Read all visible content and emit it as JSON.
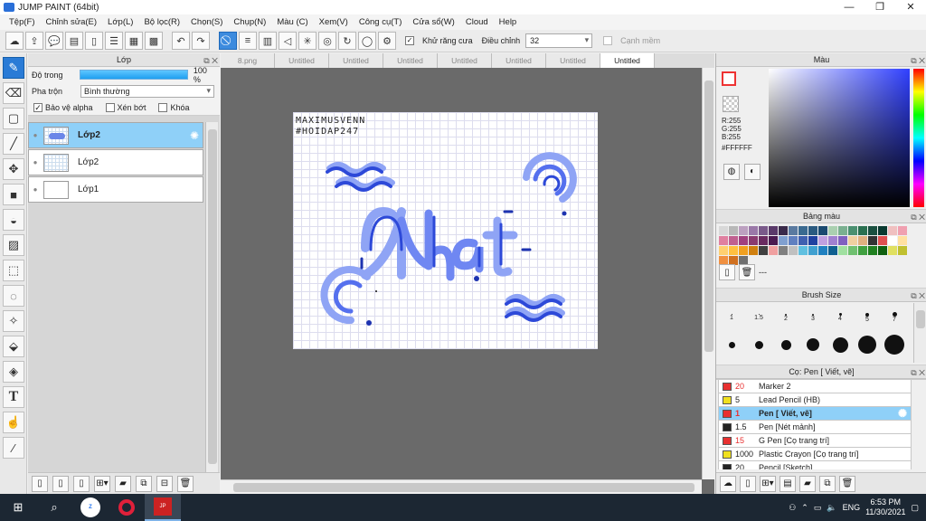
{
  "window": {
    "title": "JUMP PAINT (64bit)"
  },
  "menu": [
    "Tệp(F)",
    "Chỉnh sửa(E)",
    "Lớp(L)",
    "Bộ lọc(R)",
    "Chọn(S)",
    "Chụp(N)",
    "Màu (C)",
    "Xem(V)",
    "Công cụ(T)",
    "Cửa sổ(W)",
    "Cloud",
    "Help"
  ],
  "toolbar": {
    "antialias_label": "Khử răng cưa",
    "adjust_label": "Điều chỉnh",
    "adjust_value": "32",
    "smooth_label": "Cạnh mềm"
  },
  "layers_panel": {
    "title": "Lớp",
    "opacity_label": "Độ trong",
    "opacity_value": "100 %",
    "blend_label": "Pha trộn",
    "blend_value": "Bình thường",
    "opt_alpha": "Bảo vệ alpha",
    "opt_clip": "Xén bớt",
    "opt_lock": "Khóa",
    "layers": [
      {
        "name": "Lớp2",
        "selected": true
      },
      {
        "name": "Lớp2",
        "selected": false
      },
      {
        "name": "Lớp1",
        "selected": false
      }
    ]
  },
  "tabs": [
    "8.png",
    "Untitled",
    "Untitled",
    "Untitled",
    "Untitled",
    "Untitled",
    "Untitled",
    "Untitled"
  ],
  "canvas": {
    "signature_line1": "MAXIMUSVENN",
    "signature_line2": "#HOIDAP247",
    "word": "Nhạt"
  },
  "color_panel": {
    "title": "Màu",
    "r": "R:255",
    "g": "G:255",
    "b": "B:255",
    "hex": "#FFFFFF"
  },
  "palette_panel": {
    "title": "Bảng màu",
    "more": "---"
  },
  "brush_size_panel": {
    "title": "Brush Size",
    "row1_labels": [
      "1",
      "1.5",
      "2",
      "3",
      "4",
      "5",
      "7"
    ]
  },
  "brush_panel": {
    "title": "Cọ: Pen [ Viết, vẽ]",
    "items": [
      {
        "color": "#e83030",
        "size": "20",
        "name": "Marker 2",
        "selected": false
      },
      {
        "color": "#f0e020",
        "size": "5",
        "name": "Lead Pencil (HB)",
        "selected": false
      },
      {
        "color": "#e83030",
        "size": "1",
        "name": "Pen [ Viết, vẽ]",
        "selected": true
      },
      {
        "color": "#222222",
        "size": "1.5",
        "name": "Pen [Nét mảnh]",
        "selected": false
      },
      {
        "color": "#e83030",
        "size": "15",
        "name": "G Pen [Cọ trang trí]",
        "selected": false
      },
      {
        "color": "#f0e020",
        "size": "1000",
        "name": "Plastic Crayon [Cọ trang trí]",
        "selected": false
      },
      {
        "color": "#222222",
        "size": "20",
        "name": "Pencil [Sketch]",
        "selected": false
      }
    ]
  },
  "taskbar": {
    "lang": "ENG",
    "time": "6:53 PM",
    "date": "11/30/2021"
  }
}
